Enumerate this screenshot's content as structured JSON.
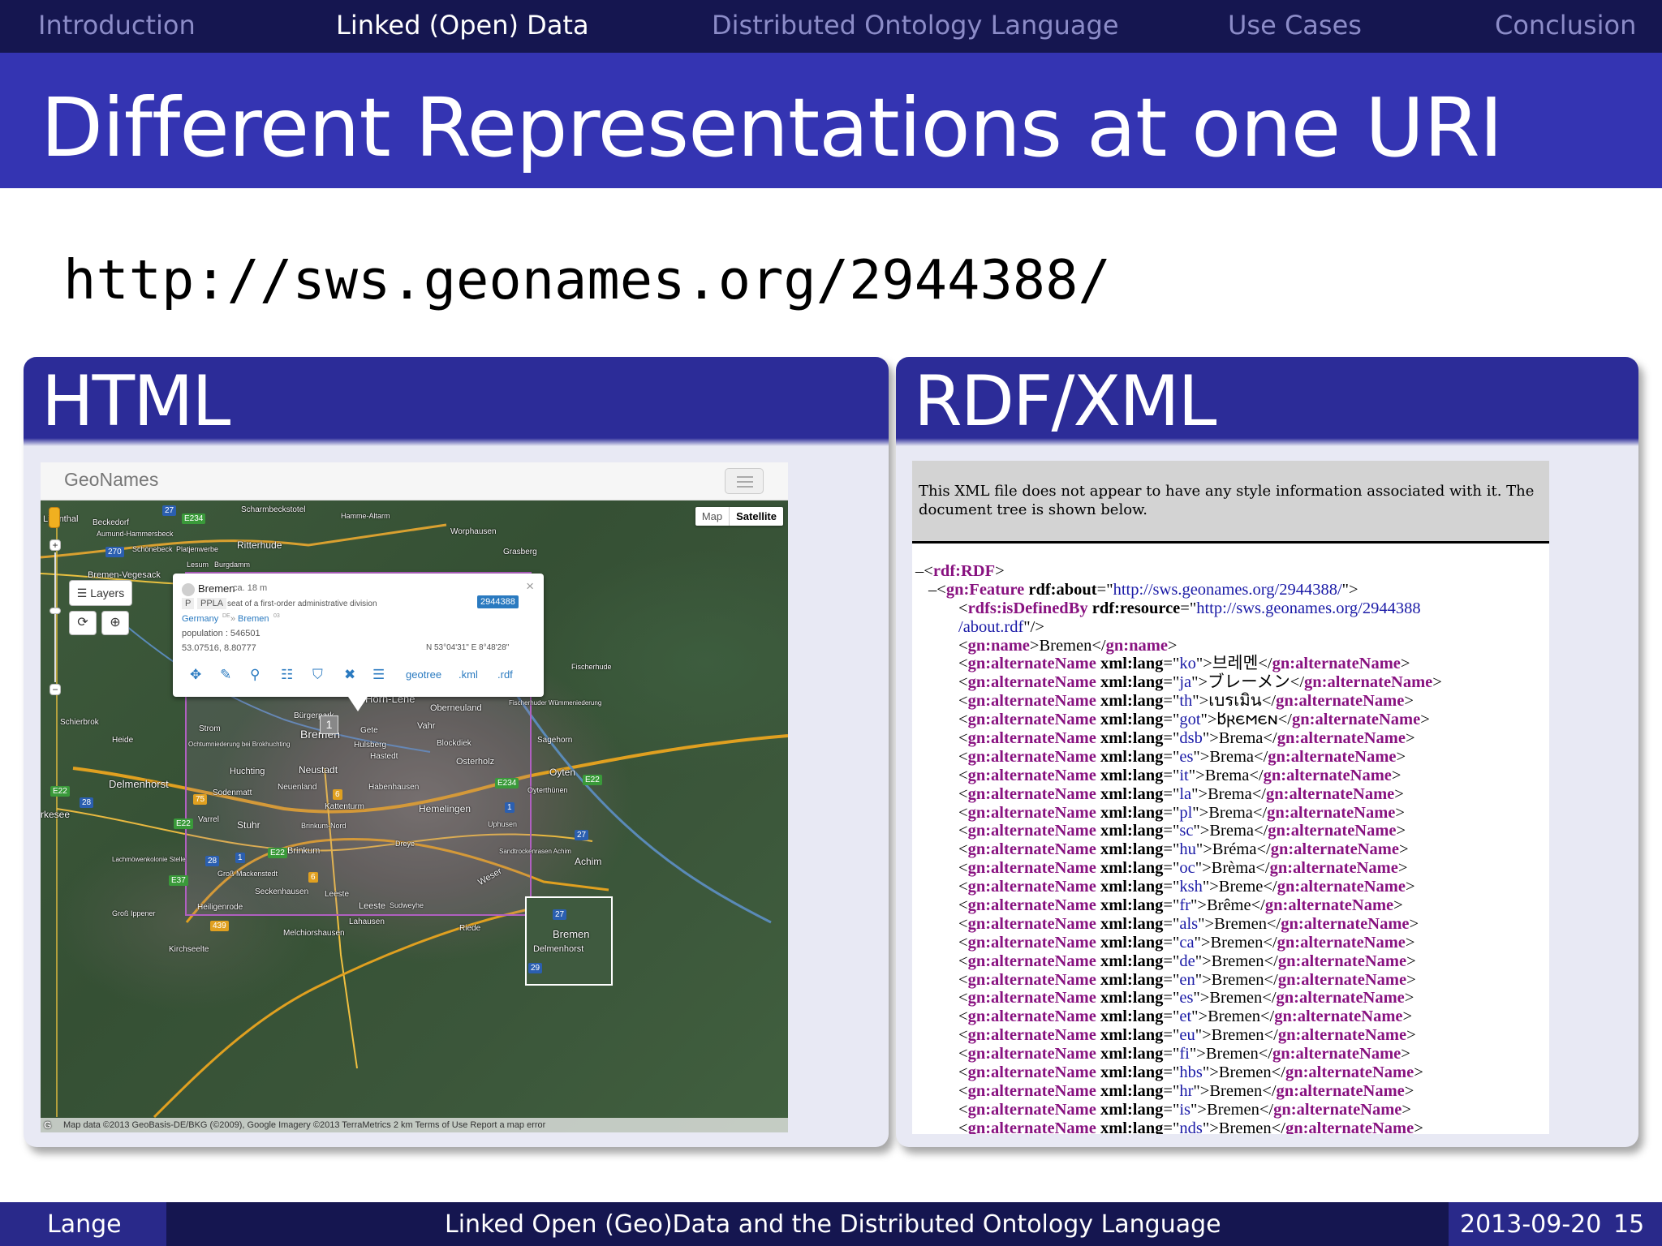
{
  "nav": {
    "items": [
      "Introduction",
      "Linked (Open) Data",
      "Distributed Ontology Language",
      "Use Cases",
      "Conclusion"
    ],
    "active_index": 1
  },
  "slide": {
    "title": "Different Representations at one URI",
    "uri": "http://sws.geonames.org/2944388/"
  },
  "html_block": {
    "title": "HTML",
    "geonames": {
      "brand": "GeoNames",
      "map_type": {
        "map": "Map",
        "satellite": "Satellite"
      },
      "layers_label": "Layers",
      "popup": {
        "name": "Bremen",
        "elevation": "ca. 18 m",
        "feature_class": "P",
        "feature_code": "PPLA",
        "feature_desc": "seat of a first-order administrative division",
        "id": "2944388",
        "country": "Germany",
        "country_code": "DE",
        "region": "Bremen",
        "region_code": "03",
        "population": "population : 546501",
        "latlng": "53.07516, 8.80777",
        "dms": "N 53°04'31\" E 8°48'28\"",
        "links": {
          "geotree": "geotree",
          "kml": ".kml",
          "rdf": ".rdf"
        }
      },
      "cluster_count": "1",
      "attribution": "Map data ©2013 GeoBasis-DE/BKG (©2009), Google Imagery ©2013 TerraMetrics   2 km   Terms of Use   Report a map error",
      "labels": {
        "scharmbeckstotel": "Scharmbeckstotel",
        "hamme": "Hamme-Altarm",
        "worphausen": "Worphausen",
        "grasberg": "Grasberg",
        "beckedorf": "Beckedorf",
        "aumund": "Aumund-Hammersbeck",
        "schonebeck": "Schönebeck",
        "platjenwerbe": "Platjenwerbe",
        "ritterhude": "Ritterhude",
        "lesum": "Lesum",
        "burgdamm": "Burgdamm",
        "bremen_veg": "Bremen-Vegesack",
        "lilienthal": "Lilienthal",
        "fischerhude": "Fischerhude",
        "horn_lehe": "Horn-Lehe",
        "oberneuland": "Oberneuland",
        "schierbrok": "Schierbrok",
        "heide": "Heide",
        "strom": "Strom",
        "ochtum": "Ochtumniederung bei Brokhuchting",
        "burglesum": "Bürgerpark",
        "bremen": "Bremen",
        "gete": "Gete",
        "vahr": "Vahr",
        "hulsberg": "Hulsberg",
        "blockdiek": "Blockdiek",
        "sagehorn": "Sagehorn",
        "hastedt": "Hastedt",
        "osterholz": "Osterholz",
        "huchting": "Huchting",
        "neustadt": "Neustadt",
        "oyten": "Oyten",
        "delmenhorst": "Delmenhorst",
        "sodenmatt": "Sodenmatt",
        "neuenland": "Neuenland",
        "habenhausen": "Habenhausen",
        "oyterthuenen": "Oyterthünen",
        "kattenturm": "Kattenturm",
        "hemelingen": "Hemelingen",
        "kesee": "rkesee",
        "varrel": "Varrel",
        "stuhr": "Stuhr",
        "brinkum_nord": "Brinkum-Nord",
        "uphusen": "Uphusen",
        "dreye": "Dreye",
        "brinkum": "Brinkum",
        "lachmoewen": "Lachmöwenkolonie Stelle",
        "gross_mack": "Groß Mackenstedt",
        "sandtrocken": "Sandtrockenrasen Achim",
        "achim": "Achim",
        "seckenhausen": "Seckenhausen",
        "leeste": "Leeste",
        "heiligenrode": "Heiligenrode",
        "sudweyhe": "Sudweyhe",
        "gross_ippener": "Groß Ippener",
        "lahausen": "Lahausen",
        "riede": "Riede",
        "melchiorshausen": "Melchiorshausen",
        "kirchseelte": "Kirchseelte",
        "weser": "Weser",
        "ov_bremen": "Bremen",
        "ov_delmenhorst": "Delmenhorst",
        "fischerhuder": "Fischerhuder Wümmeniederung"
      },
      "roads": {
        "e234a": "E234",
        "r27a": "27",
        "r270": "270",
        "r75": "75",
        "r6a": "6",
        "e22a": "E22",
        "r28a": "28",
        "e22b": "E22",
        "r1a": "1",
        "e22c": "E22",
        "r28b": "28",
        "r6b": "6",
        "e37": "E37",
        "r439": "439",
        "e234b": "E234",
        "e22d": "E22",
        "r1b": "1",
        "r27b": "27",
        "ov27": "27",
        "ov29": "29"
      }
    }
  },
  "rdf_block": {
    "title": "RDF/XML",
    "info": "This XML file does not appear to have any style information associated with it. The document tree is shown below.",
    "rdf_open": "rdf:RDF",
    "feature_tag": "gn:Feature",
    "feature_attr": "rdf:about",
    "feature_value": "http://sws.geonames.org/2944388/",
    "defined_tag": "rdfs:isDefinedBy",
    "defined_attr": "rdf:resource",
    "defined_value_1": "http://sws.geonames.org/2944388",
    "defined_value_2": "/about.rdf",
    "name_tag": "gn:name",
    "name_value": "Bremen",
    "alt_tag": "gn:alternateName",
    "alt_attr": "xml:lang",
    "alternate_names": [
      {
        "lang": "ko",
        "name": "브레멘"
      },
      {
        "lang": "ja",
        "name": "ブレーメン"
      },
      {
        "lang": "th",
        "name": "เบรเมิน"
      },
      {
        "lang": "got",
        "name": "𐌱𐍂𐌴𐌼𐌴𐌽"
      },
      {
        "lang": "dsb",
        "name": "Brema"
      },
      {
        "lang": "es",
        "name": "Brema"
      },
      {
        "lang": "it",
        "name": "Brema"
      },
      {
        "lang": "la",
        "name": "Brema"
      },
      {
        "lang": "pl",
        "name": "Brema"
      },
      {
        "lang": "sc",
        "name": "Brema"
      },
      {
        "lang": "hu",
        "name": "Bréma"
      },
      {
        "lang": "oc",
        "name": "Brèma"
      },
      {
        "lang": "ksh",
        "name": "Breme"
      },
      {
        "lang": "fr",
        "name": "Brême"
      },
      {
        "lang": "als",
        "name": "Bremen"
      },
      {
        "lang": "ca",
        "name": "Bremen"
      },
      {
        "lang": "de",
        "name": "Bremen"
      },
      {
        "lang": "en",
        "name": "Bremen"
      },
      {
        "lang": "es",
        "name": "Bremen"
      },
      {
        "lang": "et",
        "name": "Bremen"
      },
      {
        "lang": "eu",
        "name": "Bremen"
      },
      {
        "lang": "fi",
        "name": "Bremen"
      },
      {
        "lang": "hbs",
        "name": "Bremen"
      },
      {
        "lang": "hr",
        "name": "Bremen"
      },
      {
        "lang": "is",
        "name": "Bremen"
      },
      {
        "lang": "nds",
        "name": "Bremen"
      }
    ]
  },
  "footer": {
    "author": "Lange",
    "talk_title": "Linked Open (Geo)Data and the Distributed Ontology Language",
    "date": "2013-09-20",
    "page": "15"
  }
}
